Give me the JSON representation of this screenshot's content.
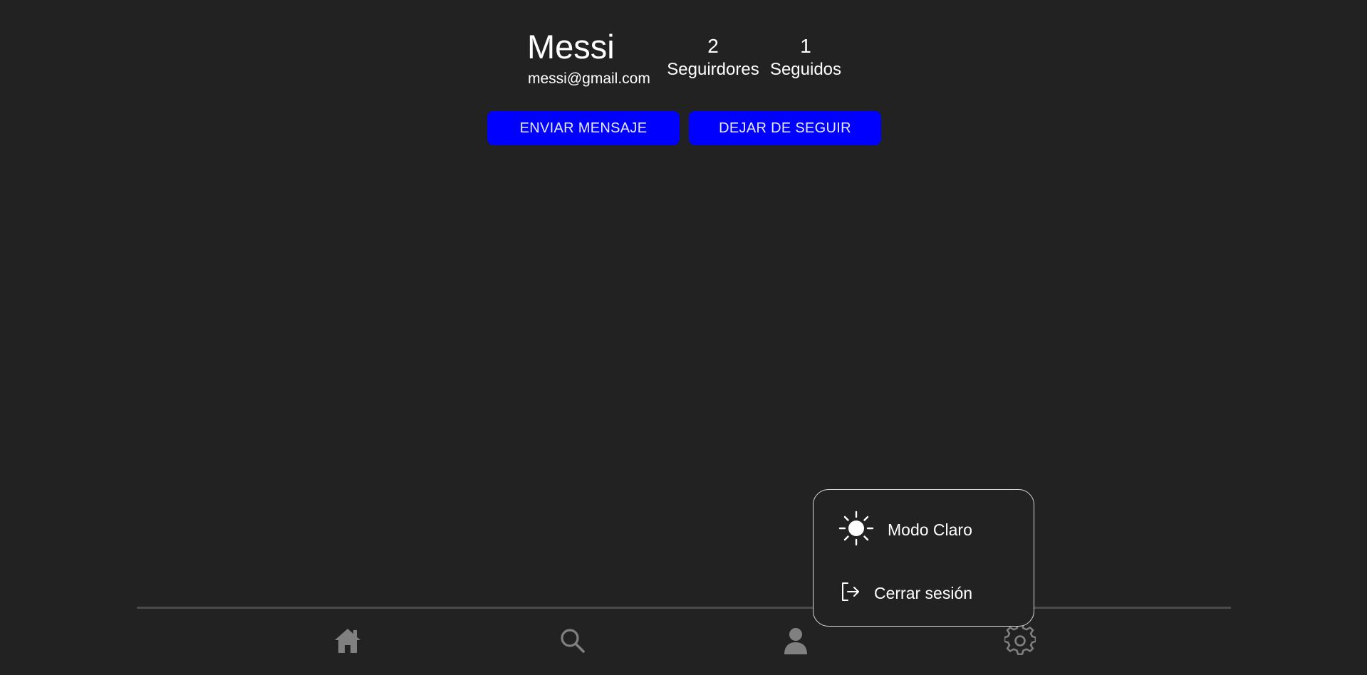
{
  "profile": {
    "name": "Messi",
    "email": "messi@gmail.com",
    "followers_count": "2",
    "followers_label": "Seguirdores",
    "following_count": "1",
    "following_label": "Seguidos"
  },
  "actions": {
    "message_label": "ENVIAR MENSAJE",
    "unfollow_label": "DEJAR DE SEGUIR"
  },
  "settings_menu": {
    "theme_label": "Modo Claro",
    "logout_label": "Cerrar sesión"
  },
  "bottom_nav": {
    "items": [
      {
        "icon": "home-icon"
      },
      {
        "icon": "search-icon"
      },
      {
        "icon": "user-icon"
      },
      {
        "icon": "gear-icon"
      }
    ]
  },
  "colors": {
    "background": "#222222",
    "button": "#0000ff",
    "nav_icon": "#808080",
    "divider": "#4a4a4a",
    "text": "#ffffff"
  }
}
